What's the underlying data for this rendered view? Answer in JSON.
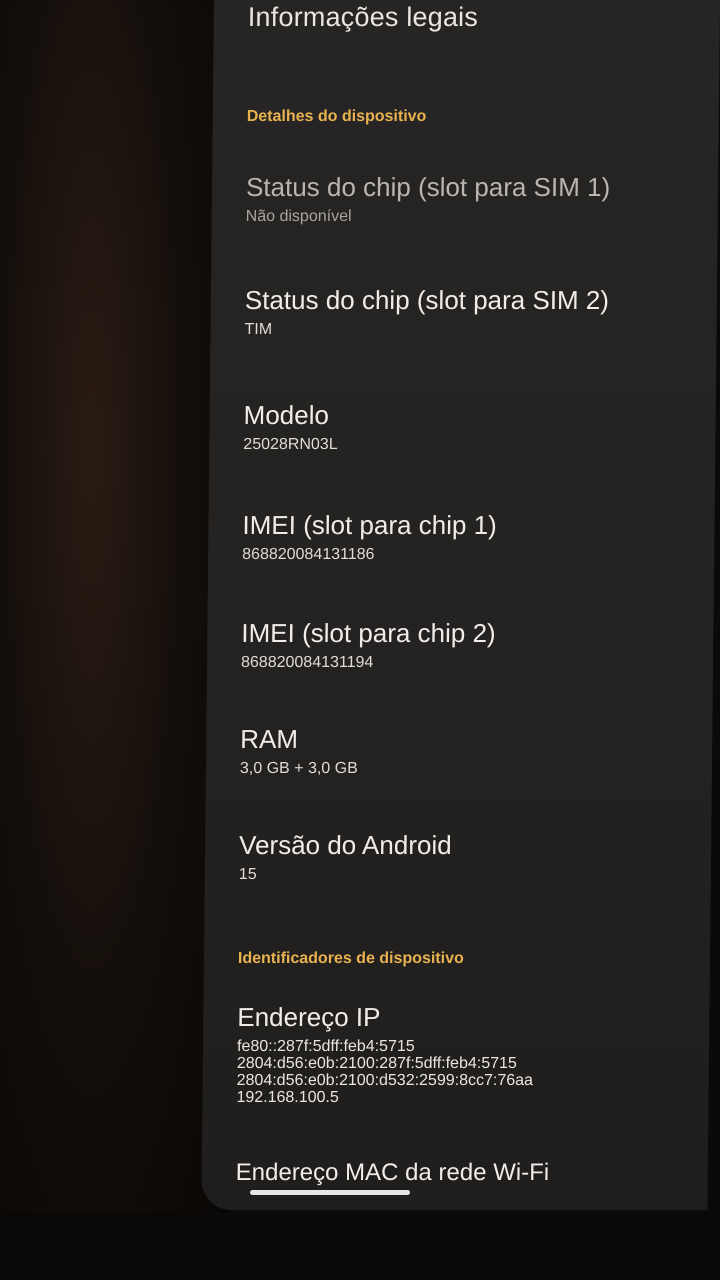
{
  "header": {
    "title": "Informações legais"
  },
  "sections": {
    "device_details": "Detalhes do dispositivo",
    "device_identifiers": "Identificadores de dispositivo"
  },
  "items": {
    "sim1": {
      "title": "Status do chip (slot para SIM 1)",
      "value": "Não disponível"
    },
    "sim2": {
      "title": "Status do chip (slot para SIM 2)",
      "value": "TIM"
    },
    "model": {
      "title": "Modelo",
      "value": "25028RN03L"
    },
    "imei1": {
      "title": "IMEI (slot para chip 1)",
      "value": "868820084131186"
    },
    "imei2": {
      "title": "IMEI (slot para chip 2)",
      "value": "868820084131194"
    },
    "ram": {
      "title": "RAM",
      "value": "3,0 GB + 3,0 GB"
    },
    "android": {
      "title": "Versão do Android",
      "value": "15"
    },
    "ip": {
      "title": "Endereço IP",
      "values": [
        "fe80::287f:5dff:feb4:5715",
        "2804:d56:e0b:2100:287f:5dff:feb4:5715",
        "2804:d56:e0b:2100:d532:2599:8cc7:76aa",
        "192.168.100.5"
      ]
    },
    "mac": {
      "title": "Endereço MAC da rede Wi-Fi"
    }
  },
  "colors": {
    "section_accent": "#e7b24f",
    "screen_background": "#252322",
    "primary_text": "#f0ede9"
  }
}
